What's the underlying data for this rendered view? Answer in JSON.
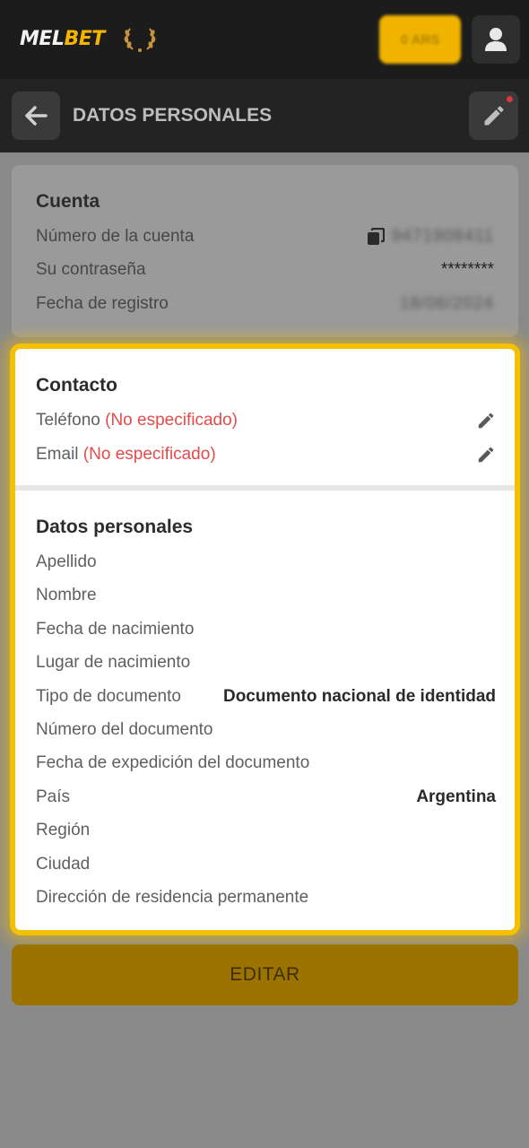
{
  "topbar": {
    "logo_part1": "MEL",
    "logo_part2": "BET",
    "balance_text": "0 ARS",
    "profile_icon": "user-icon"
  },
  "pagebar": {
    "title": "DATOS PERSONALES",
    "back_icon": "arrow-left-icon",
    "edit_icon": "pencil-icon"
  },
  "account": {
    "title": "Cuenta",
    "account_number_label": "Número de la cuenta",
    "account_number_value": "9471908411",
    "password_label": "Su contraseña",
    "password_value": "********",
    "reg_date_label": "Fecha de registro",
    "reg_date_value": "18/06/2024"
  },
  "contact": {
    "title": "Contacto",
    "phone_label": "Teléfono",
    "phone_status": "(No especificado)",
    "email_label": "Email",
    "email_status": "(No especificado)"
  },
  "personal": {
    "title": "Datos personales",
    "fields": [
      {
        "label": "Apellido",
        "value": ""
      },
      {
        "label": "Nombre",
        "value": ""
      },
      {
        "label": "Fecha de nacimiento",
        "value": ""
      },
      {
        "label": "Lugar de nacimiento",
        "value": ""
      },
      {
        "label": "Tipo de documento",
        "value": "Documento nacional de identidad"
      },
      {
        "label": "Número del documento",
        "value": ""
      },
      {
        "label": "Fecha de expedición del documento",
        "value": ""
      },
      {
        "label": "País",
        "value": "Argentina"
      },
      {
        "label": "Región",
        "value": ""
      },
      {
        "label": "Ciudad",
        "value": ""
      },
      {
        "label": "Dirección de residencia permanente",
        "value": ""
      }
    ]
  },
  "actions": {
    "edit_label": "EDITAR"
  },
  "colors": {
    "accent": "#f5c000",
    "error": "#e34b4b",
    "bar": "#1c1c1c"
  }
}
